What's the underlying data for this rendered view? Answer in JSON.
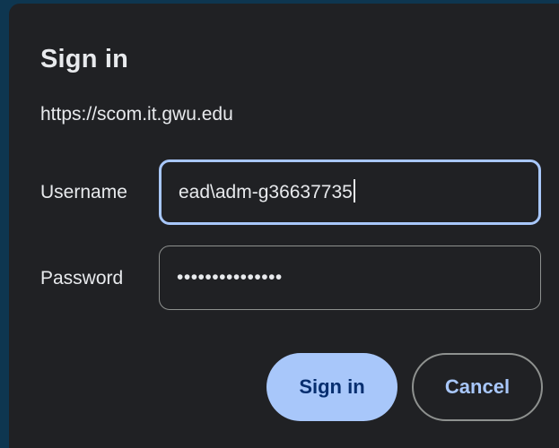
{
  "dialog": {
    "title": "Sign in",
    "origin": "https://scom.it.gwu.edu",
    "username_label": "Username",
    "username_value": "ead\\adm-g36637735",
    "password_label": "Password",
    "password_value": "•••••••••••••••",
    "sign_in_label": "Sign in",
    "cancel_label": "Cancel"
  },
  "colors": {
    "backdrop": "#0e3650",
    "dialog_bg": "#202124",
    "text": "#e8eaed",
    "accent": "#a8c7fa",
    "accent_text": "#062e6f",
    "outline": "#8e918f"
  }
}
